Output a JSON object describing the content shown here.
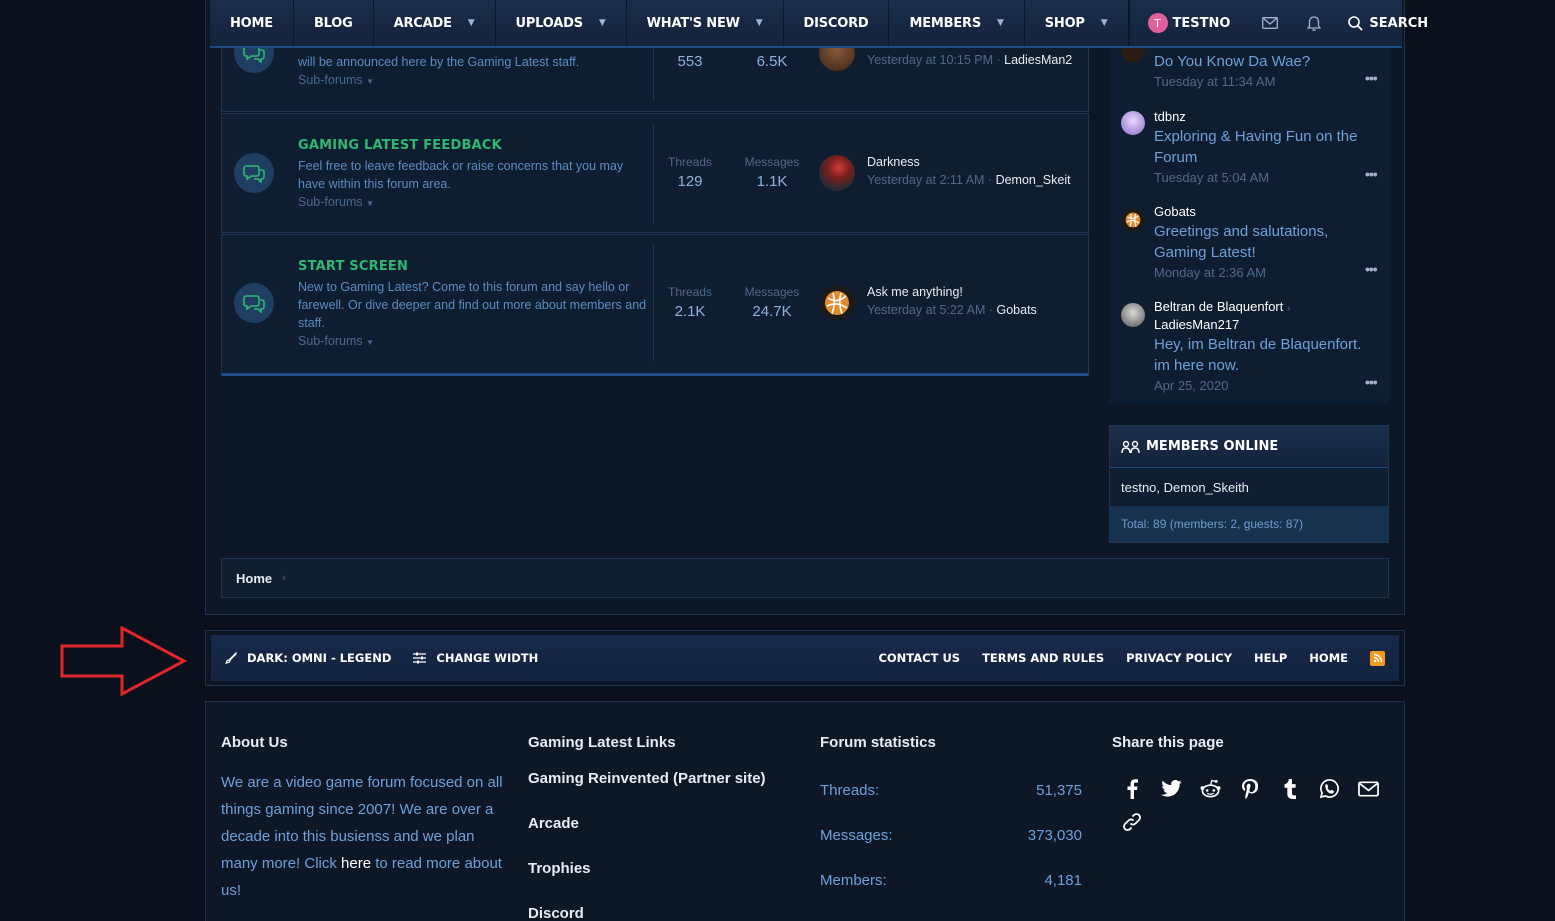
{
  "nav": {
    "items": [
      {
        "label": "HOME",
        "caret": false
      },
      {
        "label": "BLOG",
        "caret": false
      },
      {
        "label": "ARCADE",
        "caret": true
      },
      {
        "label": "UPLOADS",
        "caret": true
      },
      {
        "label": "WHAT'S NEW",
        "caret": true
      },
      {
        "label": "DISCORD",
        "caret": false
      },
      {
        "label": "MEMBERS",
        "caret": true
      },
      {
        "label": "SHOP",
        "caret": true
      }
    ],
    "user_initial": "T",
    "user_name": "TESTNO",
    "search_label": "SEARCH"
  },
  "nodes": [
    {
      "desc": "will be announced here by the Gaming Latest staff.",
      "sub": "Sub-forums",
      "threads": "553",
      "messages": "6.5K",
      "last_meta_time": "Yesterday at 10:15 PM",
      "last_user": "LadiesMan2"
    },
    {
      "title": "GAMING LATEST FEEDBACK",
      "desc": "Feel free to leave feedback or raise concerns that you may have within this forum area.",
      "sub": "Sub-forums",
      "threads_label": "Threads",
      "threads": "129",
      "messages_label": "Messages",
      "messages": "1.1K",
      "last_title": "Darkness",
      "last_meta_time": "Yesterday at 2:11 AM",
      "last_user": "Demon_Skeit"
    },
    {
      "title": "START SCREEN",
      "desc": "New to Gaming Latest? Come to this forum and say hello or farewell. Or dive deeper and find out more about members and staff.",
      "sub": "Sub-forums",
      "threads_label": "Threads",
      "threads": "2.1K",
      "messages_label": "Messages",
      "messages": "24.7K",
      "last_title": "Ask me anything!",
      "last_meta_time": "Yesterday at 5:22 AM",
      "last_user": "Gobats"
    }
  ],
  "sidebar": {
    "posts": [
      {
        "title": "Do You Know Da Wae?",
        "date": "Tuesday at 11:34 AM"
      },
      {
        "name": "tdbnz",
        "title": "Exploring & Having Fun on the Forum",
        "date": "Tuesday at 5:04 AM"
      },
      {
        "name": "Gobats",
        "title": "Greetings and salutations, Gaming Latest!",
        "date": "Monday at 2:36 AM"
      },
      {
        "name": "Beltran de Blaquenfort",
        "name2": "LadiesMan217",
        "title": "Hey, im Beltran de Blaquenfort. im here now.",
        "date": "Apr 25, 2020"
      }
    ],
    "more_label": "•••",
    "members_online": {
      "title": "MEMBERS ONLINE",
      "list": "testno, Demon_Skeith",
      "total": "Total: 89 (members: 2, guests: 87)"
    }
  },
  "breadcrumb": {
    "home": "Home"
  },
  "footer_bar": {
    "style_label": "DARK: OMNI - LEGEND",
    "width_label": "CHANGE WIDTH",
    "links": [
      "CONTACT US",
      "TERMS AND RULES",
      "PRIVACY POLICY",
      "HELP",
      "HOME"
    ]
  },
  "footer": {
    "about_title": "About Us",
    "about_text": "We are a video game forum focused on all things gaming since 2007! We are over a decade into this busienss and we plan many more! Click ",
    "about_here": "here",
    "about_tail": " to read more about us!",
    "links_title": "Gaming Latest Links",
    "links": [
      "Gaming Reinvented (Partner site)",
      "Arcade",
      "Trophies",
      "Discord"
    ],
    "stats_title": "Forum statistics",
    "stats": [
      {
        "label": "Threads:",
        "value": "51,375"
      },
      {
        "label": "Messages:",
        "value": "373,030"
      },
      {
        "label": "Members:",
        "value": "4,181"
      }
    ],
    "share_title": "Share this page",
    "share_icons": [
      "facebook-icon",
      "twitter-icon",
      "reddit-icon",
      "pinterest-icon",
      "tumblr-icon",
      "whatsapp-icon",
      "email-icon",
      "link-icon"
    ]
  },
  "colors": {
    "accent_green": "#2eb872",
    "link_blue": "#6fa0d8",
    "arrow_red": "#e0262a",
    "rss_orange": "#f39a1e"
  }
}
